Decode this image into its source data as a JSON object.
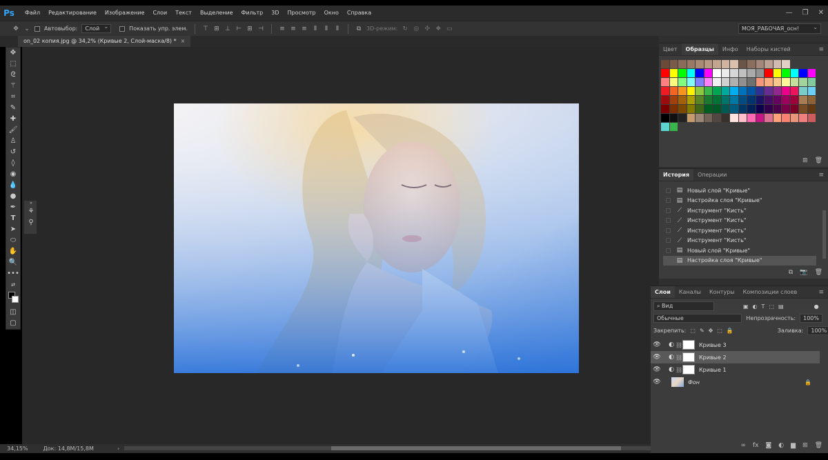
{
  "app": {
    "logo": "Ps"
  },
  "menu": [
    "Файл",
    "Редактирование",
    "Изображение",
    "Слои",
    "Текст",
    "Выделение",
    "Фильтр",
    "3D",
    "Просмотр",
    "Окно",
    "Справка"
  ],
  "window_controls": {
    "minimize": "—",
    "restore": "❐",
    "close": "✕"
  },
  "options": {
    "autoselect_label": "Автовыбор:",
    "autoselect_value": "Слой",
    "show_transform_label": "Показать упр. элем.",
    "mode3d_label": "3D-режим:",
    "workspace": "МОЯ_РАБОЧАЯ_осн!"
  },
  "document_tab": {
    "title": "on_02 копия.jpg @ 34,2% (Кривые 2, Слой-маска/8) *",
    "close": "×"
  },
  "status": {
    "zoom": "34,15%",
    "doc_info": "Док: 14,8M/15,8M"
  },
  "swatches_panel": {
    "tabs": [
      "Цвет",
      "Образцы",
      "Инфо",
      "Наборы кистей"
    ],
    "active_tab": "Образцы",
    "rows": [
      [
        "#6b4a3a",
        "#7a5b4a",
        "#8c6b58",
        "#9a7a66",
        "#a98a74",
        "#b89882",
        "#c3a58f",
        "#cfb39e",
        "#d9c1ad",
        "#6b5548",
        "#8a6f5e",
        "#a4877a",
        "#baa194",
        "#d1bbb0",
        "#e2cfc6"
      ],
      [
        "#ff0000",
        "#ffff00",
        "#00ff00",
        "#00ffff",
        "#0000ff",
        "#ff00ff",
        "#ffffff",
        "#ebebeb",
        "#d6d6d6",
        "#c0c0c0",
        "#aaaaaa",
        "#939393",
        "#ff0000",
        "#ffff00",
        "#00ff00",
        "#00ffff",
        "#0000ff",
        "#ff00ff"
      ],
      [
        "#ff8080",
        "#ffff80",
        "#80ff80",
        "#80ffff",
        "#8080ff",
        "#ff80ff",
        "#f0f0f0",
        "#d0d0d0",
        "#b0b0b0",
        "#909090",
        "#707070",
        "#f7977a",
        "#f9ad81",
        "#fdc68a",
        "#fff79a",
        "#c4df9b",
        "#a2d39c",
        "#82ca9d"
      ],
      [
        "#ed1c24",
        "#f26522",
        "#f7941d",
        "#fff200",
        "#8dc63f",
        "#39b54a",
        "#00a651",
        "#00a99d",
        "#00aeef",
        "#0072bc",
        "#0054a6",
        "#2e3192",
        "#662d91",
        "#92278f",
        "#ec008c",
        "#ed145b",
        "#7accc8",
        "#6dcff6"
      ],
      [
        "#9e0b0f",
        "#a0410d",
        "#a36209",
        "#aba000",
        "#598527",
        "#1a7b30",
        "#007236",
        "#00746b",
        "#0076a3",
        "#004b80",
        "#003471",
        "#1b1464",
        "#440e62",
        "#630460",
        "#9e005d",
        "#9e0039",
        "#a67c52",
        "#8c6239"
      ],
      [
        "#790000",
        "#7b2e00",
        "#7d4900",
        "#827b00",
        "#406618",
        "#005e20",
        "#005826",
        "#005952",
        "#005b7f",
        "#003663",
        "#002157",
        "#0d004c",
        "#32004b",
        "#4b0049",
        "#7b0046",
        "#7a0026",
        "#754c24",
        "#603913"
      ],
      [
        "#000000",
        "#111111",
        "#222222",
        "#c69c6d",
        "#998675",
        "#736357",
        "#534741",
        "#37302d",
        "#ffe4e1",
        "#ffc0cb",
        "#ff69b4",
        "#c71585",
        "#db7093",
        "#ffa07a",
        "#fa8072",
        "#e9967a",
        "#f08080",
        "#cd5c5c"
      ],
      [
        "#5fd3cf",
        "#38b54a"
      ]
    ],
    "footer_icons": [
      "new-swatch-icon",
      "trash-icon"
    ]
  },
  "history_panel": {
    "tabs": [
      "История",
      "Операции"
    ],
    "active_tab": "История",
    "items": [
      {
        "label": "Новый слой \"Кривые\"",
        "icon": "doc",
        "selected": false
      },
      {
        "label": "Настройка слоя \"Кривые\"",
        "icon": "doc",
        "selected": false
      },
      {
        "label": "Инструмент \"Кисть\"",
        "icon": "brush",
        "selected": false
      },
      {
        "label": "Инструмент \"Кисть\"",
        "icon": "brush",
        "selected": false
      },
      {
        "label": "Инструмент \"Кисть\"",
        "icon": "brush",
        "selected": false
      },
      {
        "label": "Инструмент \"Кисть\"",
        "icon": "brush",
        "selected": false
      },
      {
        "label": "Новый слой \"Кривые\"",
        "icon": "doc",
        "selected": false
      },
      {
        "label": "Настройка слоя \"Кривые\"",
        "icon": "doc",
        "selected": true
      }
    ]
  },
  "layers_panel": {
    "tabs": [
      "Слои",
      "Каналы",
      "Контуры",
      "Композиции слоев"
    ],
    "active_tab": "Слои",
    "filter_label": "Вид",
    "blend_mode": "Обычные",
    "opacity_label": "Непрозрачность:",
    "opacity_value": "100%",
    "lock_label": "Закрепить:",
    "fill_label": "Заливка:",
    "fill_value": "100%",
    "layers": [
      {
        "name": "Кривые 3",
        "type": "adjustment",
        "selected": false
      },
      {
        "name": "Кривые 2",
        "type": "adjustment",
        "selected": true
      },
      {
        "name": "Кривые 1",
        "type": "adjustment",
        "selected": false
      },
      {
        "name": "Фон",
        "type": "background",
        "selected": false
      }
    ]
  }
}
